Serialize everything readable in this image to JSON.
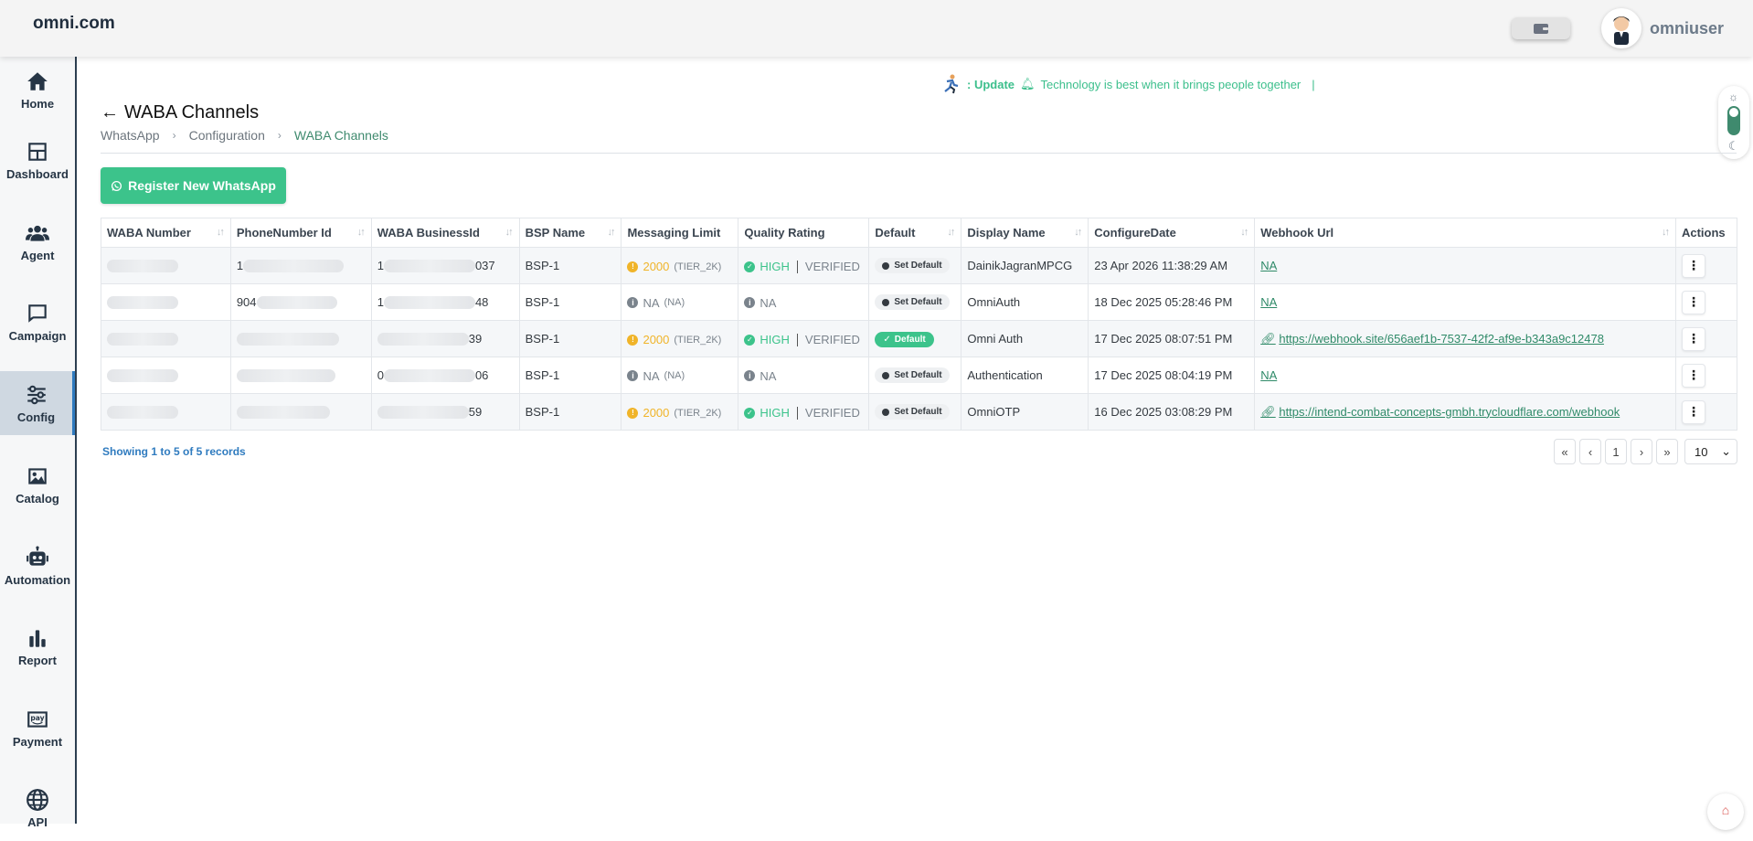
{
  "header": {
    "logo": "omni.com",
    "username": "omniuser",
    "wallet_icon": "wallet-icon"
  },
  "sidebar": {
    "items": [
      {
        "label": "Home",
        "icon": "home-icon"
      },
      {
        "label": "Dashboard",
        "icon": "dashboard-icon"
      },
      {
        "label": "Agent",
        "icon": "agent-icon"
      },
      {
        "label": "Campaign",
        "icon": "chat-icon"
      },
      {
        "label": "Config",
        "icon": "sliders-icon",
        "active": true
      },
      {
        "label": "Catalog",
        "icon": "image-icon"
      },
      {
        "label": "Automation",
        "icon": "robot-icon"
      },
      {
        "label": "Report",
        "icon": "bar-chart-icon"
      },
      {
        "label": "Payment",
        "icon": "pay-icon"
      },
      {
        "label": "API",
        "icon": "globe-icon"
      }
    ]
  },
  "announcement": {
    "prefix": ": Update",
    "message": "Technology is best when it brings people together",
    "cursor": "|"
  },
  "page": {
    "title": "WABA Channels",
    "breadcrumb": [
      "WhatsApp",
      "Configuration",
      "WABA Channels"
    ],
    "register_button": "Register New WhatsApp"
  },
  "table": {
    "columns": [
      "WABA Number",
      "PhoneNumber Id",
      "WABA BusinessId",
      "BSP Name",
      "Messaging Limit",
      "Quality Rating",
      "Default",
      "Display Name",
      "ConfigureDate",
      "Webhook Url",
      "Actions"
    ],
    "rows": [
      {
        "phone_prefix": "1",
        "business_prefix": "1",
        "business_tail": "037",
        "bsp": "BSP-1",
        "limit": "2000",
        "tier": "(TIER_2K)",
        "quality": "HIGH",
        "status": "VERIFIED",
        "default": "Set Default",
        "display_name": "DainikJagranMPCG",
        "date": "23 Apr 2026 11:38:29 AM",
        "webhook": "NA"
      },
      {
        "phone_prefix": "904",
        "business_prefix": "1",
        "business_tail": "48",
        "bsp": "BSP-1",
        "limit": "NA",
        "tier": "(NA)",
        "quality": "NA",
        "status": "",
        "default": "Set Default",
        "display_name": "OmniAuth",
        "date": "18 Dec 2025 05:28:46 PM",
        "webhook": "NA"
      },
      {
        "phone_prefix": "",
        "business_prefix": "",
        "business_tail": "39",
        "bsp": "BSP-1",
        "limit": "2000",
        "tier": "(TIER_2K)",
        "quality": "HIGH",
        "status": "VERIFIED",
        "default": "Default",
        "display_name": "Omni Auth",
        "date": "17 Dec 2025 08:07:51 PM",
        "webhook": "https://webhook.site/656aef1b-7537-42f2-af9e-b343a9c12478"
      },
      {
        "phone_prefix": "",
        "business_prefix": "0",
        "business_tail": "06",
        "bsp": "BSP-1",
        "limit": "NA",
        "tier": "(NA)",
        "quality": "NA",
        "status": "",
        "default": "Set Default",
        "display_name": "Authentication",
        "date": "17 Dec 2025 08:04:19 PM",
        "webhook": "NA"
      },
      {
        "phone_prefix": "",
        "business_prefix": "",
        "business_tail": "59",
        "bsp": "BSP-1",
        "limit": "2000",
        "tier": "(TIER_2K)",
        "quality": "HIGH",
        "status": "VERIFIED",
        "default": "Set Default",
        "display_name": "OmniOTP",
        "date": "16 Dec 2025 03:08:29 PM",
        "webhook": "https://intend-combat-concepts-gmbh.trycloudflare.com/webhook"
      }
    ]
  },
  "footer": {
    "records_text": "Showing 1 to 5 of 5 records",
    "pagination": [
      "«",
      "‹",
      "1",
      "›",
      "»"
    ],
    "page_size": "10"
  },
  "colors": {
    "accent": "#3cc38b",
    "link": "#2f8a68",
    "warning": "#f0b429"
  }
}
